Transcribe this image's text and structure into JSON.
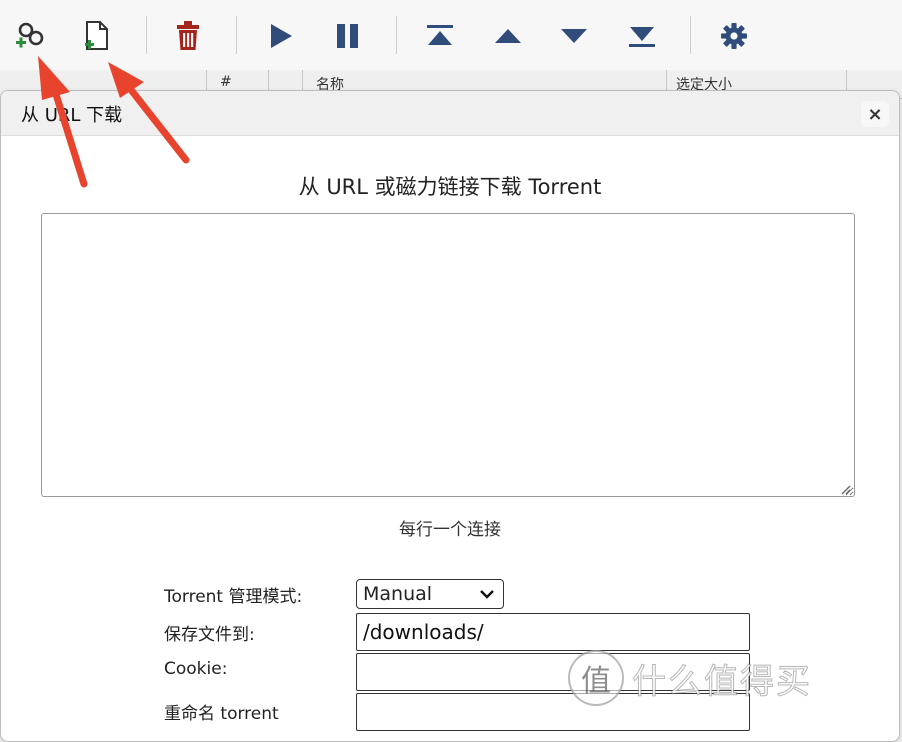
{
  "toolbar": {
    "icons": [
      "add-link-icon",
      "add-file-icon",
      "trash-icon",
      "play-icon",
      "pause-icon",
      "move-top-icon",
      "move-up-icon",
      "move-down-icon",
      "move-bottom-icon",
      "gear-icon"
    ]
  },
  "table": {
    "columns": [
      "#",
      "名称",
      "选定大小"
    ]
  },
  "dialog": {
    "title": "从 URL 下载",
    "close_glyph": "×",
    "heading": "从 URL 或磁力链接下载 Torrent",
    "url_text": "",
    "hint": "每行一个连接",
    "fields": {
      "mode_label": "Torrent 管理模式:",
      "mode_value": "Manual",
      "save_label": "保存文件到:",
      "save_value": "/downloads/",
      "cookie_label": "Cookie:",
      "cookie_value": "",
      "rename_label": "重命名 torrent",
      "rename_value": ""
    }
  },
  "watermark": {
    "badge": "值",
    "text": "什么值得买"
  },
  "colors": {
    "icon_blue": "#2f4c7a",
    "trash_red": "#a3241d",
    "arrow_red": "#e8432d"
  }
}
